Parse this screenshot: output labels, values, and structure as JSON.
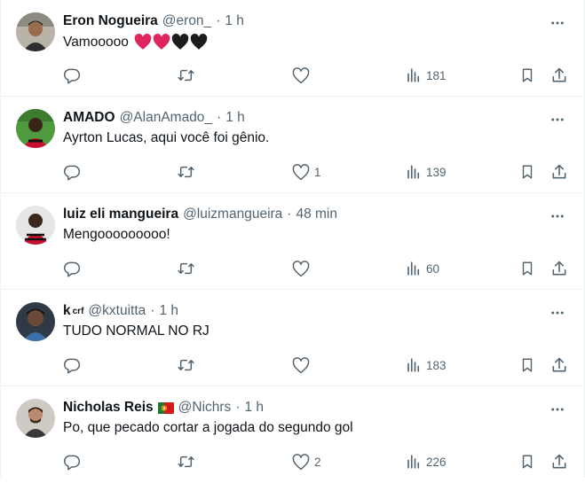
{
  "colors": {
    "text": "#0f1419",
    "muted": "#536471",
    "divider": "#eff3f4",
    "heart_red": "#e0245e",
    "heart_black": "#1c1c1c"
  },
  "icons": {
    "reply": "reply-icon",
    "retweet": "retweet-icon",
    "like": "like-icon",
    "views": "views-icon",
    "bookmark": "bookmark-icon",
    "share": "share-icon",
    "more": "more-icon"
  },
  "tweets": [
    {
      "name": "Eron Nogueira",
      "handle": "@eron_",
      "sep": "·",
      "time": "1 h",
      "text": "Vamooooo",
      "emoji": [
        "red-heart",
        "red-heart",
        "black-heart",
        "black-heart"
      ],
      "replies": "",
      "retweets": "",
      "likes": "",
      "views": "181"
    },
    {
      "name": "AMADO",
      "handle": "@AlanAmado_",
      "sep": "·",
      "time": "1 h",
      "text": "Ayrton Lucas, aqui você foi gênio.",
      "replies": "",
      "retweets": "",
      "likes": "1",
      "views": "139"
    },
    {
      "name": "luiz eli mangueira",
      "handle": "@luizmangueira",
      "sep": "·",
      "time": "48 min",
      "text": "Mengooooooooo!",
      "replies": "",
      "retweets": "",
      "likes": "",
      "views": "60"
    },
    {
      "name": "k",
      "name_sup": "crf",
      "handle": "@kxtuitta",
      "sep": "·",
      "time": "1 h",
      "text": "TUDO NORMAL NO RJ",
      "replies": "",
      "retweets": "",
      "likes": "",
      "views": "183"
    },
    {
      "name": "Nicholas Reis",
      "flag": "portugal-flag",
      "handle": "@Nichrs",
      "sep": "·",
      "time": "1 h",
      "text": "Po, que pecado cortar a jogada do segundo gol",
      "replies": "",
      "retweets": "",
      "likes": "2",
      "views": "226"
    }
  ]
}
